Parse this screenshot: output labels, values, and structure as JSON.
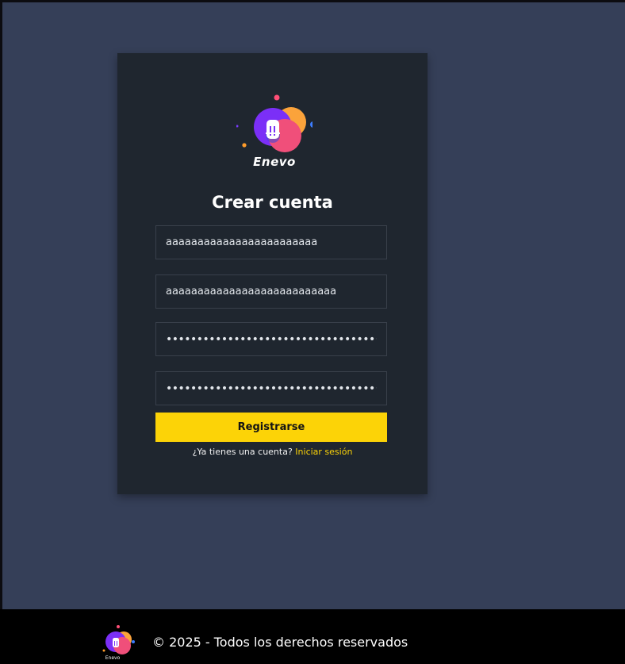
{
  "brand": {
    "name": "Enevo",
    "logo_icon": "enevo-bubble-logo-icon"
  },
  "form": {
    "title": "Crear cuenta",
    "fields": [
      {
        "type": "text",
        "value": "aaaaaaaaaaaaaaaaaaaaaaaa"
      },
      {
        "type": "text",
        "value": "aaaaaaaaaaaaaaaaaaaaaaaaaaa"
      },
      {
        "type": "password",
        "value": "••••••••••••••••••••••••••••••••••••••••••"
      },
      {
        "type": "password",
        "value": "••••••••••••••••••••••••••••••••••••••••••"
      }
    ],
    "submit_label": "Registrarse",
    "login_prompt": "¿Ya tienes una cuenta?",
    "login_link": "Iniciar sesión"
  },
  "footer": {
    "copyright": "© 2025 - Todos los derechos reservados",
    "logo_text": "Enevo"
  },
  "colors": {
    "page_background": "#353f58",
    "card_background": "#1f262f",
    "accent": "#fcd307",
    "footer_background": "#000000"
  }
}
